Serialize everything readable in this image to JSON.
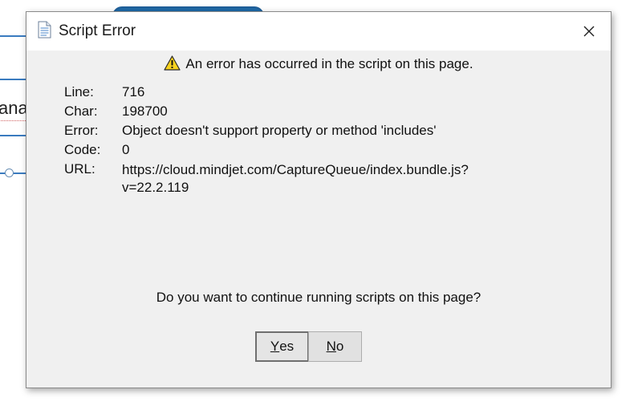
{
  "background": {
    "node_text": "ana"
  },
  "dialog": {
    "title": "Script Error",
    "header": "An error has occurred in the script on this page.",
    "details": [
      {
        "label": "Line:",
        "value": "716"
      },
      {
        "label": "Char:",
        "value": "198700"
      },
      {
        "label": "Error:",
        "value": "Object doesn't support property or method 'includes'"
      },
      {
        "label": "Code:",
        "value": "0"
      }
    ],
    "url": {
      "label": "URL:",
      "value_line1": "https://cloud.mindjet.com/CaptureQueue/index.bundle.js?",
      "value_line2": "v=22.2.119"
    },
    "question": "Do you want to continue running scripts on this page?",
    "buttons": {
      "yes": {
        "mnemonic": "Y",
        "rest": "es"
      },
      "no": {
        "mnemonic": "N",
        "rest": "o"
      }
    }
  },
  "icons": {
    "title": "document-icon",
    "warning": "warning-icon",
    "close": "close-icon"
  },
  "colors": {
    "dialog_bg": "#f0f0f0",
    "titlebar_bg": "#ffffff",
    "warning_yellow": "#f7d21e",
    "mindmap_blue": "#1f6aa8"
  }
}
